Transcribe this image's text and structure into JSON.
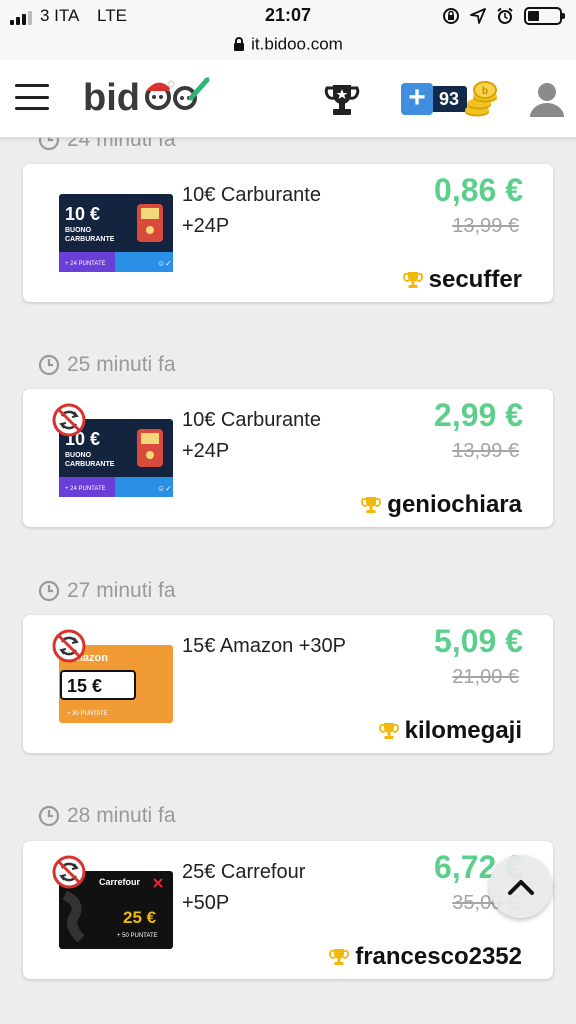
{
  "status_bar": {
    "carrier": "3 ITA",
    "network": "LTE",
    "time": "21:07",
    "battery_level": 0.35
  },
  "url_bar": {
    "url": "it.bidoo.com"
  },
  "header": {
    "logo_text": "bidoo",
    "credit_count": "93",
    "plus_label": "+"
  },
  "colors": {
    "price_green": "#5ccf8d",
    "winner_gold": "#f2b807",
    "credit_blue": "#3f8ee0"
  },
  "auctions": [
    {
      "time_ago": "24 minuti fa",
      "product": "10€ Carburante +24P",
      "thumb": {
        "type": "fuel",
        "amount": "10 €",
        "line1": "BUONO",
        "line2": "CARBURANTE",
        "bonus": "+ 24 PUNTATE"
      },
      "no_bid_badge": false,
      "price": "0,86 €",
      "old_price": "13,99 €",
      "winner": "secuffer"
    },
    {
      "time_ago": "25 minuti fa",
      "product": "10€ Carburante +24P",
      "thumb": {
        "type": "fuel",
        "amount": "10 €",
        "line1": "BUONO",
        "line2": "CARBURANTE",
        "bonus": "+ 24 PUNTATE"
      },
      "no_bid_badge": true,
      "price": "2,99 €",
      "old_price": "13,99 €",
      "winner": "geniochiara"
    },
    {
      "time_ago": "27 minuti fa",
      "product": "15€ Amazon +30P",
      "thumb": {
        "type": "amazon",
        "brand": "amazon",
        "amount": "15 €",
        "bonus": "+ 30 PUNTATE"
      },
      "no_bid_badge": true,
      "price": "5,09 €",
      "old_price": "21,00 €",
      "winner": "kilomegaji"
    },
    {
      "time_ago": "28 minuti fa",
      "product": "25€ Carrefour +50P",
      "thumb": {
        "type": "carrefour",
        "brand": "Carrefour",
        "amount": "25 €",
        "bonus": "+ 50 PUNTATE"
      },
      "no_bid_badge": true,
      "price": "6,72 €",
      "old_price": "35,00 €",
      "winner": "francesco2352"
    }
  ]
}
